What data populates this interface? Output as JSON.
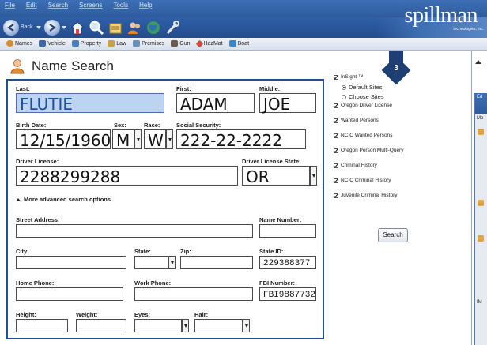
{
  "menubar": {
    "items": [
      "File",
      "Edit",
      "Search",
      "Screens",
      "Tools",
      "Help"
    ]
  },
  "toolbar": {
    "back_label": "Back"
  },
  "brand": {
    "logo": "spillman",
    "tagline": "technologies, inc."
  },
  "navbar": {
    "items": [
      {
        "label": "Names",
        "color": "#d88a2b"
      },
      {
        "label": "Vehicle",
        "color": "#3f67a8"
      },
      {
        "label": "Property",
        "color": "#4a7fc4"
      },
      {
        "label": "Law",
        "color": "#c7a24a"
      },
      {
        "label": "Premises",
        "color": "#6a8fb8"
      },
      {
        "label": "Gun",
        "color": "#6b5a4b"
      },
      {
        "label": "HazMat",
        "color": "#d14b3f"
      },
      {
        "label": "Boat",
        "color": "#3c86c8"
      }
    ]
  },
  "page": {
    "title": "Name Search",
    "title_icon": "person-icon"
  },
  "form": {
    "last": {
      "label": "Last:",
      "value": "FLUTIE"
    },
    "first": {
      "label": "First:",
      "value": "ADAM"
    },
    "middle": {
      "label": "Middle:",
      "value": "JOE"
    },
    "birth": {
      "label": "Birth Date:",
      "value": "12/15/1960"
    },
    "sex": {
      "label": "Sex:",
      "value": "M"
    },
    "race": {
      "label": "Race:",
      "value": "W"
    },
    "ssn": {
      "label": "Social Security:",
      "value": "222-22-2222"
    },
    "dl": {
      "label": "Driver License:",
      "value": "2288299288"
    },
    "dl_state": {
      "label": "Driver License State:",
      "value": "OR"
    },
    "advanced": "More advanced search options",
    "street": {
      "label": "Street Address:",
      "value": ""
    },
    "name_number": {
      "label": "Name Number:",
      "value": ""
    },
    "city": {
      "label": "City:",
      "value": ""
    },
    "state": {
      "label": "State:",
      "value": ""
    },
    "zip": {
      "label": "Zip:",
      "value": ""
    },
    "state_id": {
      "label": "State ID:",
      "value": "229388377"
    },
    "home_phone": {
      "label": "Home Phone:",
      "value": ""
    },
    "work_phone": {
      "label": "Work Phone:",
      "value": ""
    },
    "fbi": {
      "label": "FBI Number:",
      "value": "FBI9887732"
    },
    "height": {
      "label": "Height:",
      "value": ""
    },
    "weight": {
      "label": "Weight:",
      "value": ""
    },
    "eyes": {
      "label": "Eyes:",
      "value": ""
    },
    "hair": {
      "label": "Hair:",
      "value": ""
    }
  },
  "sources": {
    "insight": "InSight ™",
    "default_sites": "Default Sites",
    "choose_sites": "Choose Sites",
    "items": [
      "Oregon Driver License",
      "Wanted Persons",
      "NCIC Wanted Persons",
      "Oregon Person Multi-Query",
      "Criminal History",
      "NCIC Criminal History",
      "Juvenile Criminal History"
    ],
    "search_label": "Search"
  },
  "badge": {
    "number": "3"
  },
  "second_window": {
    "title": "Ed",
    "row": "Mo",
    "bottom": "IM"
  }
}
